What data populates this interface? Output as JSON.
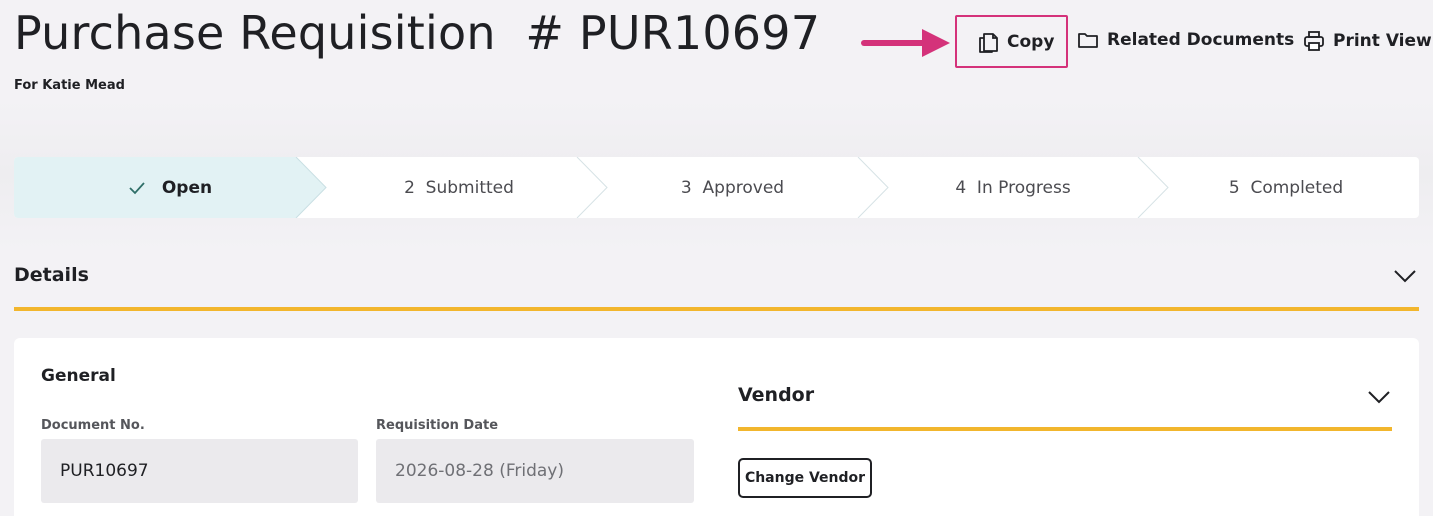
{
  "header": {
    "title": "Purchase Requisition  # PUR10697",
    "subtitle": "For Katie Mead"
  },
  "toolbar": {
    "copy_label": "Copy",
    "related_label": "Related Documents",
    "print_label": "Print View"
  },
  "stepper": {
    "steps": [
      {
        "label": "Open",
        "state": "done"
      },
      {
        "label": "2  Submitted",
        "state": "pending"
      },
      {
        "label": "3  Approved",
        "state": "pending"
      },
      {
        "label": "4  In Progress",
        "state": "pending"
      },
      {
        "label": "5  Completed",
        "state": "pending"
      }
    ]
  },
  "details": {
    "title": "Details",
    "general_title": "General",
    "document_no_label": "Document No.",
    "document_no_value": "PUR10697",
    "requisition_date_label": "Requisition Date",
    "requisition_date_value": "2026-08-28 (Friday)"
  },
  "vendor": {
    "title": "Vendor",
    "change_label": "Change Vendor"
  },
  "colors": {
    "accent": "#f2b62d",
    "highlight": "#d4327a",
    "active_step": "#e2f2f4"
  }
}
